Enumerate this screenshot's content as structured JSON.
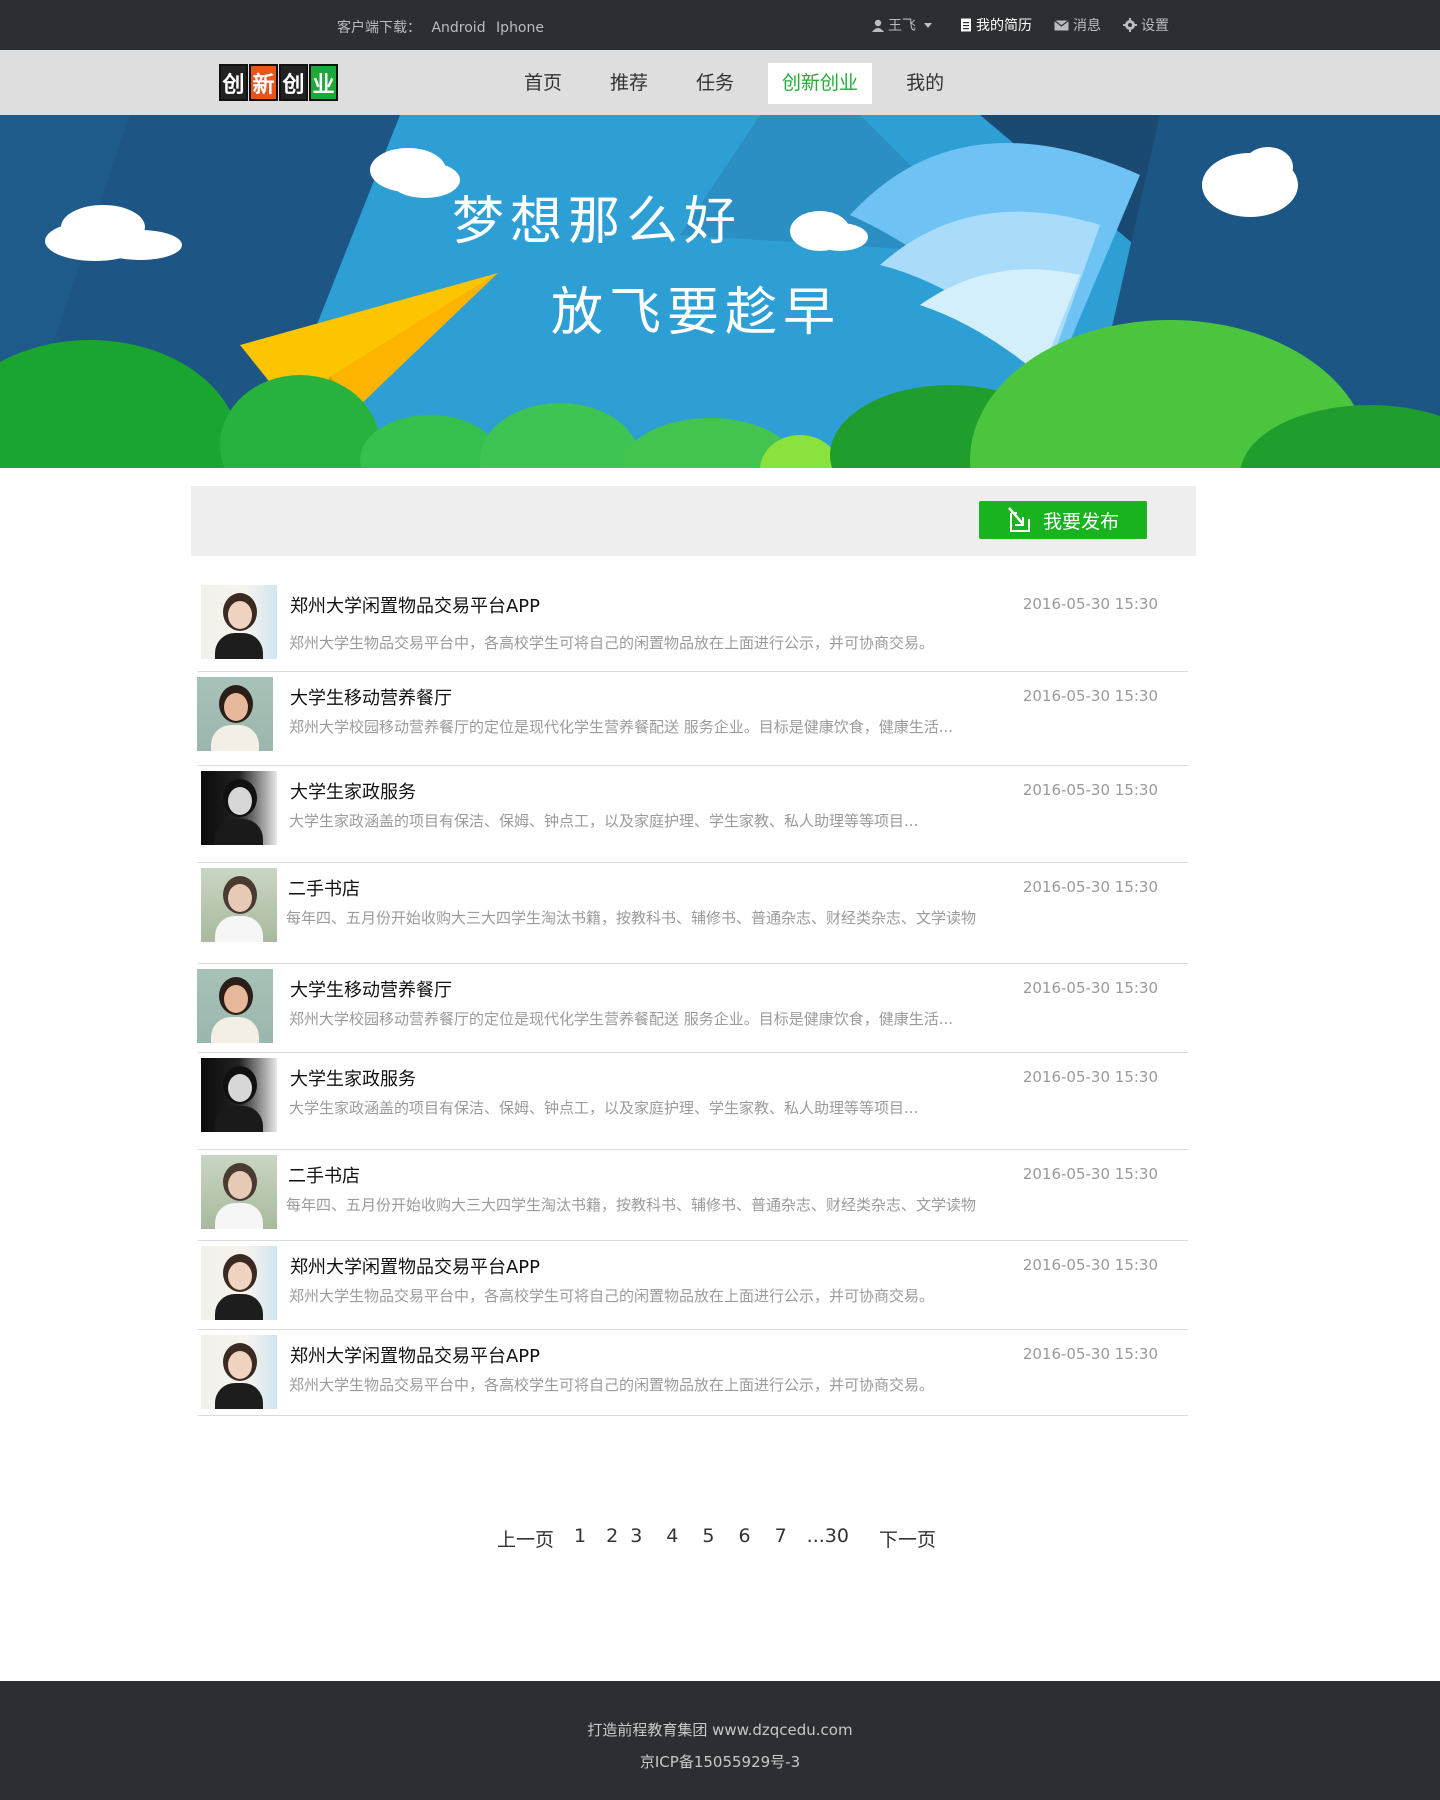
{
  "topbar": {
    "download_label": "客户端下载：",
    "android": "Android",
    "iphone": "Iphone",
    "user": "王飞",
    "resume": "我的简历",
    "messages": "消息",
    "settings": "设置"
  },
  "logo": {
    "chars": [
      "创",
      "新",
      "创",
      "业"
    ],
    "colors": [
      "#222222",
      "#e8541c",
      "#222222",
      "#1fa83a"
    ]
  },
  "nav": {
    "items": [
      "首页",
      "推荐",
      "任务",
      "创新创业",
      "我的"
    ],
    "active_index": 3
  },
  "banner": {
    "line1": "梦想那么好",
    "line2": "放飞要趁早"
  },
  "actionbar": {
    "publish_label": "我要发布"
  },
  "list": [
    {
      "title": "郑州大学闲置物品交易平台APP",
      "desc": "郑州大学生物品交易平台中，各高校学生可将自己的闲置物品放在上面进行公示，并可协商交易。",
      "time": "2016-05-30 15:30",
      "avatar": "girl-hair-icon"
    },
    {
      "title": "大学生移动营养餐厅",
      "desc": "郑州大学校园移动营养餐厅的定位是现代化学生营养餐配送 服务企业。目标是健康饮食，健康生活...",
      "time": "2016-05-30 15:30",
      "avatar": "boy-sky-icon"
    },
    {
      "title": "大学生家政服务",
      "desc": "大学生家政涵盖的项目有保洁、保姆、钟点工，以及家庭护理、学生家教、私人助理等等项目...",
      "time": "2016-05-30 15:30",
      "avatar": "bw-portrait-icon"
    },
    {
      "title": "二手书店",
      "desc": "每年四、五月份开始收购大三大四学生淘汰书籍，按教科书、辅修书、普通杂志、财经类杂志、文学读物",
      "time": "2016-05-30 15:30",
      "avatar": "girl-field-icon"
    },
    {
      "title": "大学生移动营养餐厅",
      "desc": "郑州大学校园移动营养餐厅的定位是现代化学生营养餐配送 服务企业。目标是健康饮食，健康生活...",
      "time": "2016-05-30 15:30",
      "avatar": "boy-sky-icon"
    },
    {
      "title": "大学生家政服务",
      "desc": "大学生家政涵盖的项目有保洁、保姆、钟点工，以及家庭护理、学生家教、私人助理等等项目...",
      "time": "2016-05-30 15:30",
      "avatar": "bw-portrait-icon"
    },
    {
      "title": "二手书店",
      "desc": "每年四、五月份开始收购大三大四学生淘汰书籍，按教科书、辅修书、普通杂志、财经类杂志、文学读物",
      "time": "2016-05-30 15:30",
      "avatar": "girl-field-icon"
    },
    {
      "title": "郑州大学闲置物品交易平台APP",
      "desc": "郑州大学生物品交易平台中，各高校学生可将自己的闲置物品放在上面进行公示，并可协商交易。",
      "time": "2016-05-30 15:30",
      "avatar": "girl-hair-icon"
    },
    {
      "title": "郑州大学闲置物品交易平台APP",
      "desc": "郑州大学生物品交易平台中，各高校学生可将自己的闲置物品放在上面进行公示，并可协商交易。",
      "time": "2016-05-30 15:30",
      "avatar": "girl-hair-icon"
    }
  ],
  "pagination": {
    "prev": "上一页",
    "pages": [
      "1",
      "2",
      "3",
      "4",
      "5",
      "6",
      "7",
      "...30"
    ],
    "next": "下一页"
  },
  "footer": {
    "line1": "打造前程教育集团 www.dzqcedu.com",
    "line2": "京ICP备15055929号-3"
  }
}
